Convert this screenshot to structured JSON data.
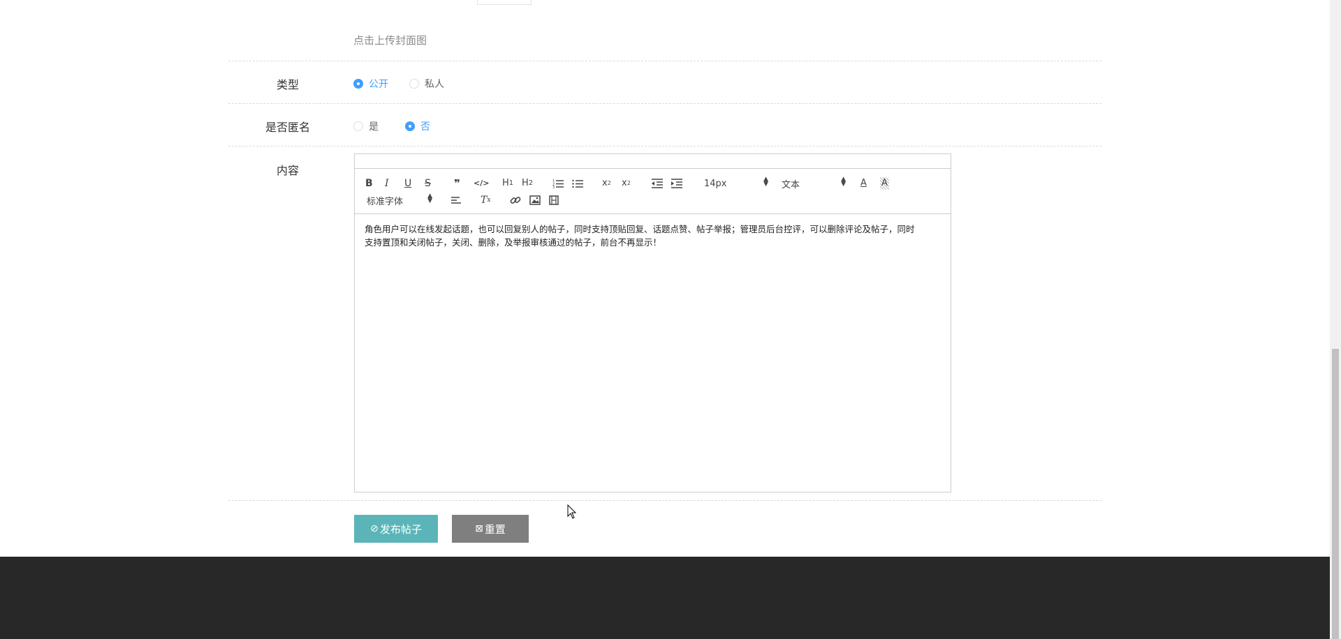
{
  "upload": {
    "hint": "点击上传封面图"
  },
  "form": {
    "type": {
      "label": "类型",
      "options": [
        {
          "label": "公开",
          "checked": true
        },
        {
          "label": "私人",
          "checked": false
        }
      ]
    },
    "anonymous": {
      "label": "是否匿名",
      "options": [
        {
          "label": "是",
          "checked": false
        },
        {
          "label": "否",
          "checked": true
        }
      ]
    },
    "content": {
      "label": "内容",
      "toolbar": {
        "font_size": "14px",
        "header_type": "文本",
        "font_family": "标准字体"
      },
      "text_line1": "角色用户可以在线发起话题，也可以回复别人的帖子，同时支持顶贴回复、话题点赞、帖子举报；管理员后台控评，可以删除评论及帖子，同时",
      "text_line2": "支持置顶和关闭帖子，关闭、删除，及举报审核通过的帖子，前台不再显示！"
    }
  },
  "buttons": {
    "submit_icon": "⊘",
    "submit_label": "发布帖子",
    "reset_icon": "⊠",
    "reset_label": "重置"
  },
  "colors": {
    "accent": "#409eff",
    "submit_bg": "#5bb5b8",
    "reset_bg": "#7f7f7f",
    "footer_bg": "#282828"
  }
}
